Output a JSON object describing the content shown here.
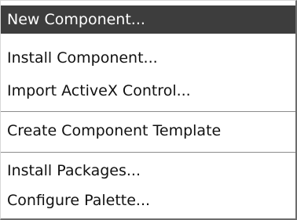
{
  "menu": {
    "items": [
      {
        "label": "New Component...",
        "selected": true
      },
      {
        "label": "Install Component..."
      },
      {
        "label": "Import ActiveX Control..."
      },
      {
        "label": "Create Component Template"
      },
      {
        "label": "Install Packages..."
      },
      {
        "label": "Configure Palette..."
      }
    ]
  },
  "colors": {
    "selected_bg": "#3d3d3d",
    "selected_text": "#ffffff",
    "text": "#111111"
  }
}
